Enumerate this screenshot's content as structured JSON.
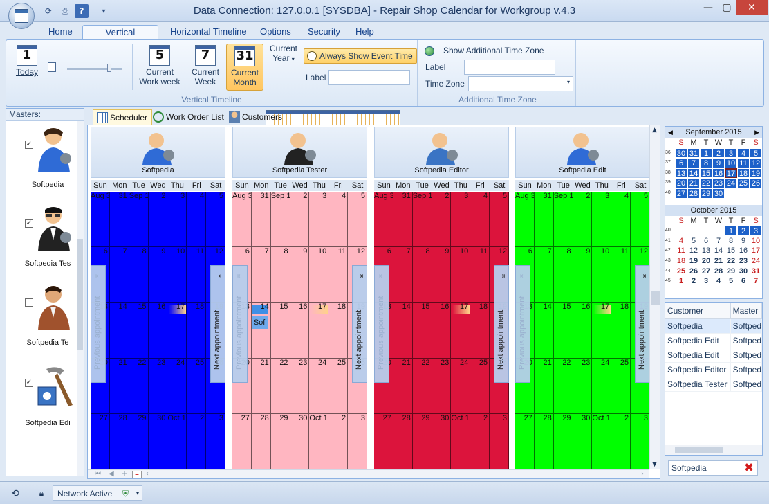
{
  "window": {
    "title": "Data Connection: 127.0.0.1 [SYSDBA] - Repair Shop Calendar for Workgroup v.4.3"
  },
  "ribbon_tabs": [
    "Home",
    "Vertical Timeline",
    "Horizontal Timeline",
    "Options",
    "Security",
    "Help"
  ],
  "ribbon": {
    "today_label": "Today",
    "today_num": "1",
    "current_work_week": {
      "num": "5",
      "line1": "Current",
      "line2": "Work week"
    },
    "current_week": {
      "num": "7",
      "line1": "Current",
      "line2": "Week"
    },
    "current_month": {
      "num": "31",
      "line1": "Current",
      "line2": "Month"
    },
    "current_year": {
      "line1": "Current",
      "line2": "Year"
    },
    "always_show_label": "Always Show Event Time",
    "label_caption": "Label",
    "group1_caption": "Vertical Timeline",
    "show_additional_tz": "Show Additional Time Zone",
    "tz_label_caption": "Label",
    "tz_caption": "Time Zone",
    "group2_caption": "Additional Time Zone"
  },
  "masters": {
    "header": "Masters:",
    "items": [
      {
        "name": "Softpedia",
        "checked": "✓"
      },
      {
        "name": "Softpedia Tes",
        "checked": "✓"
      },
      {
        "name": "Softpedia Te",
        "checked": ""
      },
      {
        "name": "Softpedia Edi",
        "checked": "✓"
      }
    ]
  },
  "main_tabs": [
    "Scheduler",
    "Work Order List",
    "Customers"
  ],
  "scheduler": {
    "day_names": [
      "Sun",
      "Mon",
      "Tue",
      "Wed",
      "Thu",
      "Fri",
      "Sat"
    ],
    "columns": [
      {
        "name": "Softpedia",
        "color": "#0000ff",
        "textcolor": "#000000"
      },
      {
        "name": "Softpedia Tester",
        "color": "#ffb6c1",
        "textcolor": "#111111"
      },
      {
        "name": "Softpedia Editor",
        "color": "#dc143c",
        "textcolor": "#111111"
      },
      {
        "name": "Softpedia Edit",
        "color": "#00ff00",
        "textcolor": "#111111"
      }
    ],
    "weeks": [
      [
        "Aug 3",
        "31",
        "Sep 1",
        "2",
        "3",
        "4",
        "5"
      ],
      [
        "6",
        "7",
        "8",
        "9",
        "10",
        "11",
        "12"
      ],
      [
        "13",
        "14",
        "15",
        "16",
        "17",
        "18",
        "19"
      ],
      [
        "20",
        "21",
        "22",
        "23",
        "24",
        "25",
        "26"
      ],
      [
        "27",
        "28",
        "29",
        "30",
        "Oct 1",
        "2",
        "3"
      ]
    ],
    "appointment_text": "Sof",
    "prev_label": "Previous appointment",
    "next_label": "Next appointment"
  },
  "september": {
    "title": "September 2015",
    "day_letters": [
      "S",
      "M",
      "T",
      "W",
      "T",
      "F",
      "S"
    ],
    "weeks": [
      {
        "wk": "36",
        "days": [
          "30",
          "31",
          "1",
          "2",
          "3",
          "4",
          "5"
        ]
      },
      {
        "wk": "37",
        "days": [
          "6",
          "7",
          "8",
          "9",
          "10",
          "11",
          "12"
        ]
      },
      {
        "wk": "38",
        "days": [
          "13",
          "14",
          "15",
          "16",
          "17",
          "18",
          "19"
        ]
      },
      {
        "wk": "39",
        "days": [
          "20",
          "21",
          "22",
          "23",
          "24",
          "25",
          "26"
        ]
      },
      {
        "wk": "40",
        "days": [
          "27",
          "28",
          "29",
          "30",
          "",
          "",
          ""
        ]
      }
    ]
  },
  "october": {
    "title": "October 2015",
    "day_letters": [
      "S",
      "M",
      "T",
      "W",
      "T",
      "F",
      "S"
    ],
    "weeks": [
      {
        "wk": "40",
        "days": [
          "",
          "",
          "",
          "",
          "1",
          "2",
          "3"
        ]
      },
      {
        "wk": "41",
        "days": [
          "4",
          "5",
          "6",
          "7",
          "8",
          "9",
          "10"
        ]
      },
      {
        "wk": "42",
        "days": [
          "11",
          "12",
          "13",
          "14",
          "15",
          "16",
          "17"
        ]
      },
      {
        "wk": "43",
        "days": [
          "18",
          "19",
          "20",
          "21",
          "22",
          "23",
          "24"
        ]
      },
      {
        "wk": "44",
        "days": [
          "25",
          "26",
          "27",
          "28",
          "29",
          "30",
          "31"
        ]
      },
      {
        "wk": "45",
        "days": [
          "1",
          "2",
          "3",
          "4",
          "5",
          "6",
          "7"
        ]
      }
    ]
  },
  "customers": {
    "headers": [
      "Customer",
      "Master"
    ],
    "rows": [
      [
        "Softpedia",
        "Softpedi"
      ],
      [
        "Softpedia Edit",
        "Softpedi"
      ],
      [
        "Softpedia Edit",
        "Softpedi"
      ],
      [
        "Softpedia Editor",
        "Softpedi"
      ],
      [
        "Softpedia Tester",
        "Softpedi"
      ]
    ],
    "filter_value": "Softpedia"
  },
  "status": {
    "network": "Network Active"
  }
}
